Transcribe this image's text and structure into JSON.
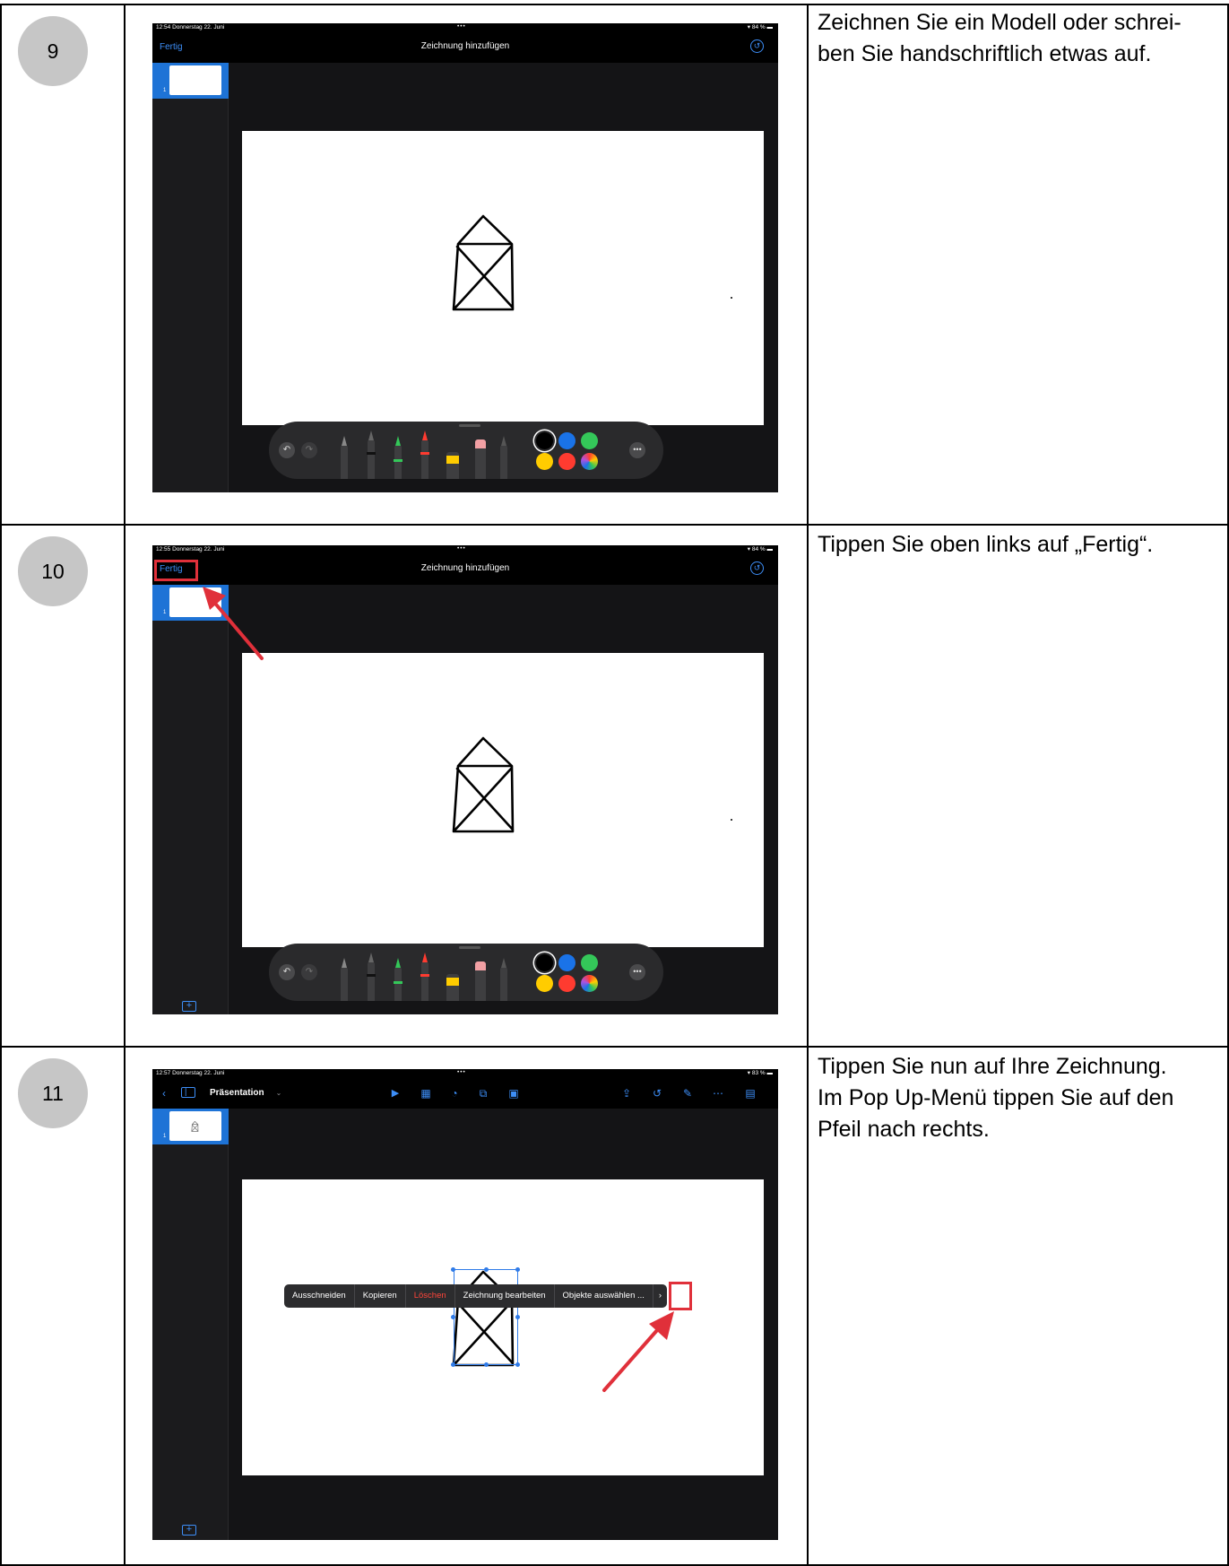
{
  "steps": [
    {
      "number": "9",
      "description": "Zeichnen Sie ein Modell oder schrei-ben Sie handschriftlich etwas auf.",
      "description_lines": [
        "Zeichnen Sie ein Modell oder schrei-",
        "ben Sie handschriftlich etwas auf."
      ],
      "screenshot": {
        "status_time": "12:54 Donnerstag 22. Juni",
        "status_dots": "•••",
        "status_battery": "84 %",
        "nav_left": "Fertig",
        "nav_title": "Zeichnung hinzufügen",
        "slide_number": "1"
      }
    },
    {
      "number": "10",
      "description": "Tippen Sie oben links auf „Fertig“.",
      "description_lines": [
        "Tippen Sie oben links auf „Fertig“."
      ],
      "screenshot": {
        "status_time": "12:55 Donnerstag 22. Juni",
        "status_dots": "•••",
        "status_battery": "84 %",
        "nav_left": "Fertig",
        "nav_title": "Zeichnung hinzufügen",
        "slide_number": "1"
      }
    },
    {
      "number": "11",
      "description": "Tippen Sie nun auf Ihre Zeichnung. Im Pop Up-Menü tippen Sie auf den Pfeil nach rechts.",
      "description_lines": [
        "Tippen Sie nun auf Ihre Zeichnung.",
        "Im Pop Up-Menü tippen Sie auf den",
        "Pfeil nach rechts."
      ],
      "screenshot": {
        "status_time": "12:57 Donnerstag 22. Juni",
        "status_dots": "•••",
        "status_battery": "83 %",
        "doc_title": "Präsentation",
        "slide_number": "1",
        "popup_menu": [
          "Ausschneiden",
          "Kopieren",
          "Löschen",
          "Zeichnung bearbeiten",
          "Objekte auswählen ..."
        ],
        "popup_more": "›"
      }
    }
  ],
  "palette_colors": [
    "#000000",
    "#1a73e8",
    "#34c759",
    "#ffcc00",
    "#ff3b30"
  ],
  "accent_color": "#3d8ef7",
  "highlight_color": "#e0303a",
  "icons": [
    "undo-icon",
    "redo-icon",
    "pen-icon",
    "marker-icon",
    "pencil-icon",
    "eraser-icon",
    "lasso-icon",
    "ruler-icon",
    "more-icon",
    "add-slide-icon",
    "back-icon",
    "sidebar-icon",
    "play-icon",
    "table-icon",
    "chart-icon",
    "shape-icon",
    "media-icon",
    "share-icon",
    "history-icon",
    "format-icon",
    "document-icon"
  ]
}
